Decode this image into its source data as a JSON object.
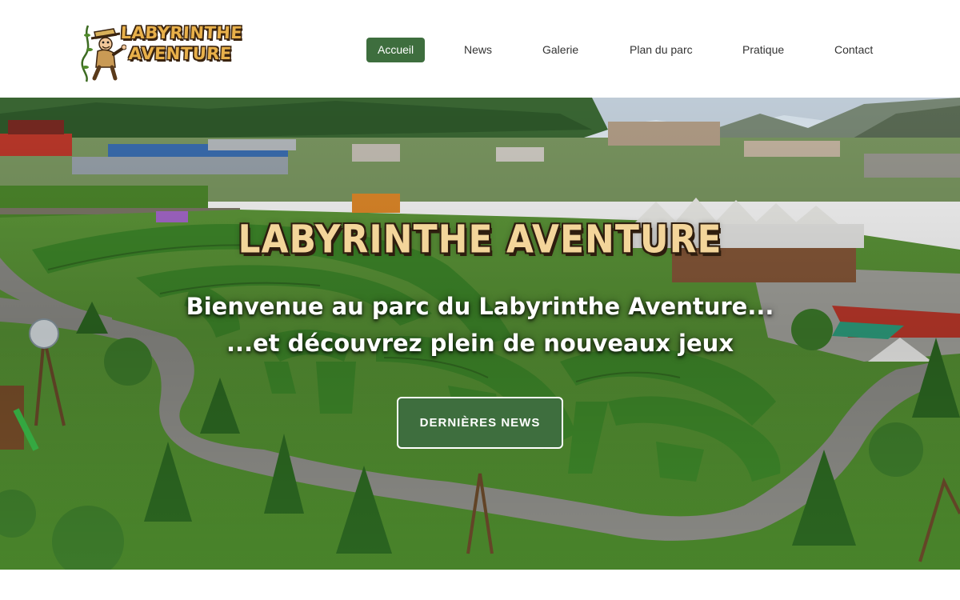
{
  "header": {
    "logo": {
      "line1": "LABYRINTHE",
      "line2": "AVENTURE"
    },
    "nav": [
      {
        "label": "Accueil",
        "active": true
      },
      {
        "label": "News"
      },
      {
        "label": "Galerie"
      },
      {
        "label": "Plan du parc"
      },
      {
        "label": "Pratique"
      },
      {
        "label": "Contact"
      }
    ]
  },
  "hero": {
    "title": "LABYRINTHE AVENTURE",
    "subtitle_line1": "Bienvenue au parc du Labyrinthe Aventure...",
    "subtitle_line2": "...et découvrez plein de nouveaux jeux",
    "cta_label": "DERNIÈRES NEWS"
  },
  "colors": {
    "accent_green": "#3e6e3e",
    "title_wood": "#f3d59a",
    "text_dark": "#333333"
  },
  "icons": {
    "logo_mascot": "explorer-mascot-icon"
  }
}
